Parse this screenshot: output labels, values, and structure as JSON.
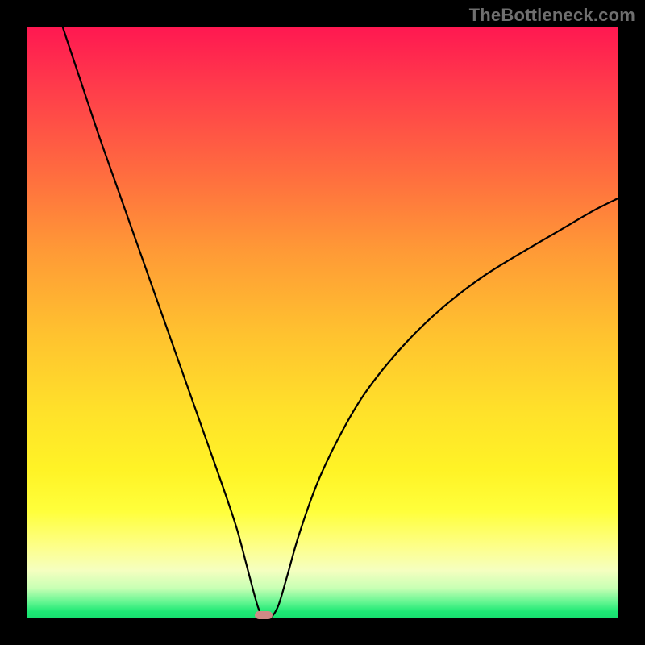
{
  "watermark": "TheBottleneck.com",
  "colors": {
    "frame": "#000000",
    "curve": "#000000",
    "marker": "#cf8a86",
    "gradient_top": "#ff1851",
    "gradient_bottom": "#18e070"
  },
  "chart_data": {
    "type": "line",
    "title": "",
    "description": "V-shaped bottleneck curve on vertical rainbow gradient; minimum near x≈0.40 at y≈0 (green zone).",
    "xlabel": "",
    "ylabel": "",
    "xlim": [
      0,
      1
    ],
    "ylim": [
      0,
      1
    ],
    "legend": false,
    "grid": false,
    "minimum_point": {
      "x": 0.4,
      "y": 0.0
    },
    "curve_points": [
      {
        "x": 0.06,
        "y": 1.0
      },
      {
        "x": 0.09,
        "y": 0.91
      },
      {
        "x": 0.12,
        "y": 0.82
      },
      {
        "x": 0.15,
        "y": 0.735
      },
      {
        "x": 0.18,
        "y": 0.65
      },
      {
        "x": 0.21,
        "y": 0.565
      },
      {
        "x": 0.24,
        "y": 0.48
      },
      {
        "x": 0.27,
        "y": 0.395
      },
      {
        "x": 0.3,
        "y": 0.31
      },
      {
        "x": 0.33,
        "y": 0.225
      },
      {
        "x": 0.355,
        "y": 0.15
      },
      {
        "x": 0.375,
        "y": 0.075
      },
      {
        "x": 0.39,
        "y": 0.02
      },
      {
        "x": 0.4,
        "y": 0.0
      },
      {
        "x": 0.412,
        "y": 0.0
      },
      {
        "x": 0.425,
        "y": 0.02
      },
      {
        "x": 0.44,
        "y": 0.07
      },
      {
        "x": 0.46,
        "y": 0.14
      },
      {
        "x": 0.49,
        "y": 0.225
      },
      {
        "x": 0.525,
        "y": 0.3
      },
      {
        "x": 0.565,
        "y": 0.37
      },
      {
        "x": 0.61,
        "y": 0.43
      },
      {
        "x": 0.66,
        "y": 0.485
      },
      {
        "x": 0.715,
        "y": 0.535
      },
      {
        "x": 0.775,
        "y": 0.58
      },
      {
        "x": 0.835,
        "y": 0.617
      },
      {
        "x": 0.9,
        "y": 0.655
      },
      {
        "x": 0.96,
        "y": 0.69
      },
      {
        "x": 1.0,
        "y": 0.71
      }
    ]
  }
}
